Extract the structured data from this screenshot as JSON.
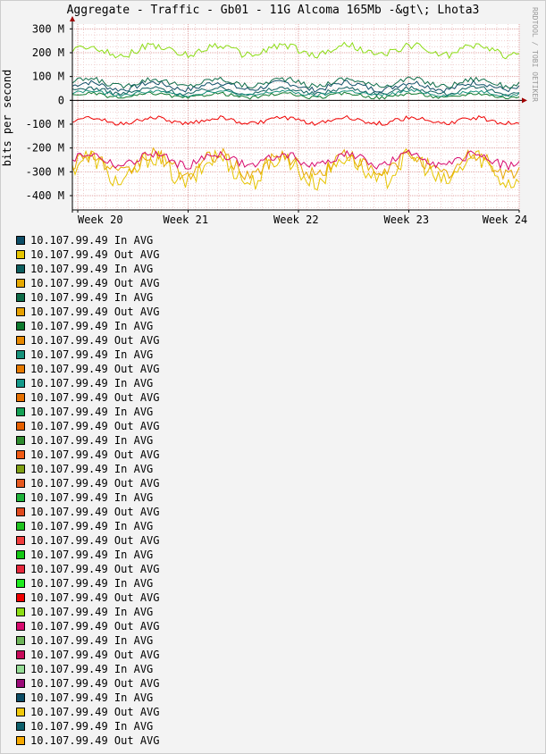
{
  "title": "Aggregate - Traffic - Gb01 - 11G Alcoma 165Mb -&gt\\; Lhota3",
  "watermark": "RRDTOOL / TOBI OETIKER",
  "chart_data": {
    "type": "line",
    "title": "Aggregate - Traffic - Gb01 - 11G Alcoma 165Mb -&gt\\; Lhota3",
    "xlabel": "",
    "ylabel": "bits per second",
    "x_ticks": [
      "Week 20",
      "Week 21",
      "Week 22",
      "Week 23",
      "Week 24"
    ],
    "y_ticks": [
      {
        "value": 300,
        "label": "300 M"
      },
      {
        "value": 200,
        "label": "200 M"
      },
      {
        "value": 100,
        "label": "100 M"
      },
      {
        "value": 0,
        "label": "0"
      },
      {
        "value": -100,
        "label": "-100 M"
      },
      {
        "value": -200,
        "label": "-200 M"
      },
      {
        "value": -300,
        "label": "-300 M"
      },
      {
        "value": -400,
        "label": "-400 M"
      }
    ],
    "ylim": [
      -460,
      320
    ],
    "grid": true,
    "legend_position": "bottom",
    "series": [
      {
        "name": "10.107.99.49 In AVG",
        "color": "#0d4d66",
        "level": 60,
        "amp": 25
      },
      {
        "name": "10.107.99.49 Out AVG",
        "color": "#e6c400",
        "level": -290,
        "amp": 90
      },
      {
        "name": "10.107.99.49 In AVG",
        "color": "#0d5f5f",
        "level": 40,
        "amp": 20
      },
      {
        "name": "10.107.99.49 Out AVG",
        "color": "#e6a800",
        "level": -270,
        "amp": 70
      },
      {
        "name": "10.107.99.49 In AVG",
        "color": "#0d6b47",
        "level": 75,
        "amp": 25
      },
      {
        "name": "10.107.99.49 Out AVG",
        "color": "#e6a000",
        "level": 0,
        "amp": 0
      },
      {
        "name": "10.107.99.49 In AVG",
        "color": "#0d7a2e",
        "level": 20,
        "amp": 15
      },
      {
        "name": "10.107.99.49 Out AVG",
        "color": "#e68800",
        "level": 0,
        "amp": 0
      },
      {
        "name": "10.107.99.49 In AVG",
        "color": "#16917a",
        "level": 30,
        "amp": 15
      },
      {
        "name": "10.107.99.49 Out AVG",
        "color": "#e67a00",
        "level": 0,
        "amp": 0
      },
      {
        "name": "10.107.99.49 In AVG",
        "color": "#14998a",
        "level": 0,
        "amp": 0
      },
      {
        "name": "10.107.99.49 Out AVG",
        "color": "#e67000",
        "level": 0,
        "amp": 0
      },
      {
        "name": "10.107.99.49 In AVG",
        "color": "#14a054",
        "level": 0,
        "amp": 0
      },
      {
        "name": "10.107.99.49 Out AVG",
        "color": "#e66000",
        "level": 0,
        "amp": 0
      },
      {
        "name": "10.107.99.49 In AVG",
        "color": "#2e8b2e",
        "level": 0,
        "amp": 0
      },
      {
        "name": "10.107.99.49 Out AVG",
        "color": "#f05a14",
        "level": 0,
        "amp": 0
      },
      {
        "name": "10.107.99.49 In AVG",
        "color": "#80a014",
        "level": 0,
        "amp": 0
      },
      {
        "name": "10.107.99.49 Out AVG",
        "color": "#e6581e",
        "level": 0,
        "amp": 0
      },
      {
        "name": "10.107.99.49 In AVG",
        "color": "#1fb33a",
        "level": 0,
        "amp": 0
      },
      {
        "name": "10.107.99.49 Out AVG",
        "color": "#e04a1e",
        "level": 0,
        "amp": 0
      },
      {
        "name": "10.107.99.49 In AVG",
        "color": "#1fc21f",
        "level": 0,
        "amp": 0
      },
      {
        "name": "10.107.99.49 Out AVG",
        "color": "#f03c3c",
        "level": 0,
        "amp": 0
      },
      {
        "name": "10.107.99.49 In AVG",
        "color": "#14c814",
        "level": 0,
        "amp": 0
      },
      {
        "name": "10.107.99.49 Out AVG",
        "color": "#e6283c",
        "level": 0,
        "amp": 0
      },
      {
        "name": "10.107.99.49 In AVG",
        "color": "#1eeb1e",
        "level": 0,
        "amp": 0
      },
      {
        "name": "10.107.99.49 Out AVG",
        "color": "#f00000",
        "level": -85,
        "amp": 20
      },
      {
        "name": "10.107.99.49 In AVG",
        "color": "#8cdc14",
        "level": 210,
        "amp": 35
      },
      {
        "name": "10.107.99.49 Out AVG",
        "color": "#d70a6e",
        "level": -250,
        "amp": 40
      },
      {
        "name": "10.107.99.49 In AVG",
        "color": "#6eb45a",
        "level": 0,
        "amp": 0
      },
      {
        "name": "10.107.99.49 Out AVG",
        "color": "#c80a5a",
        "level": 0,
        "amp": 0
      },
      {
        "name": "10.107.99.49 In AVG",
        "color": "#96dc96",
        "level": 0,
        "amp": 0
      },
      {
        "name": "10.107.99.49 Out AVG",
        "color": "#9b0a78",
        "level": 0,
        "amp": 0
      },
      {
        "name": "10.107.99.49 In AVG",
        "color": "#0d4d66",
        "level": 0,
        "amp": 0
      },
      {
        "name": "10.107.99.49 Out AVG",
        "color": "#f0c80a",
        "level": 0,
        "amp": 0
      },
      {
        "name": "10.107.99.49 In AVG",
        "color": "#0d5f6b",
        "level": 0,
        "amp": 0
      },
      {
        "name": "10.107.99.49 Out AVG",
        "color": "#f5a800",
        "level": 0,
        "amp": 0
      }
    ]
  }
}
